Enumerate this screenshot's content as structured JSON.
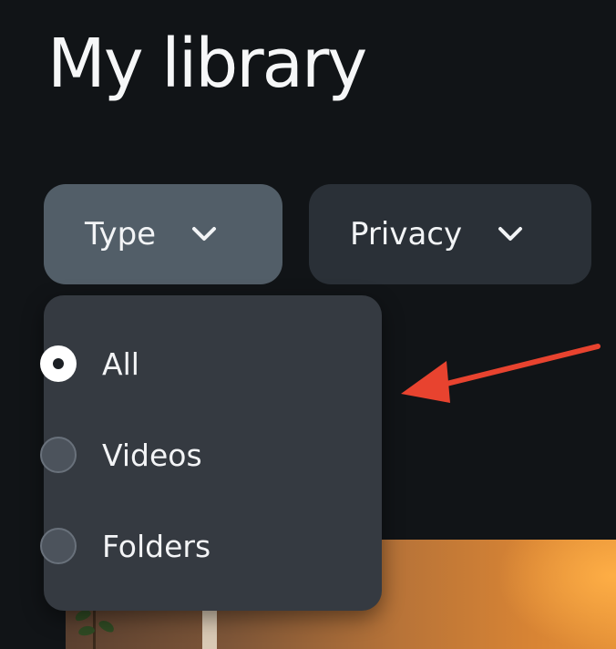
{
  "page": {
    "title": "My library"
  },
  "filters": {
    "type_label": "Type",
    "privacy_label": "Privacy",
    "chevron_icon": "chevron-down-icon"
  },
  "type_dropdown": {
    "options": [
      {
        "label": "All",
        "selected": true
      },
      {
        "label": "Videos",
        "selected": false
      },
      {
        "label": "Folders",
        "selected": false
      }
    ]
  },
  "colors": {
    "background": "#111417",
    "type_button": "#525e68",
    "privacy_button": "#2a3037",
    "dropdown": "#353a41",
    "annotation_arrow": "#e8432f"
  }
}
